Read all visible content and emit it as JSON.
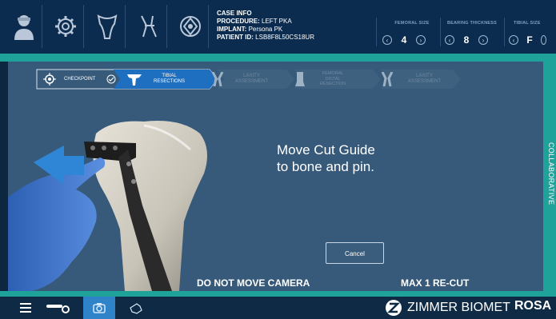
{
  "header": {
    "case_title": "CASE INFO",
    "procedure_label": "PROCEDURE:",
    "procedure_value": "LEFT PKA",
    "implant_label": "IMPLANT:",
    "implant_value": "Persona PK",
    "patient_label": "PATIENT ID:",
    "patient_value": "LSB8F8L50CS18UR",
    "femoral_size_label": "FEMORAL SIZE",
    "femoral_size_value": "4",
    "bearing_label": "BEARING THICKNESS",
    "bearing_value": "8",
    "tibial_label": "TIBIAL SIZE",
    "tibial_value": "F",
    "icons": [
      "surgeon-icon",
      "settings-gear-icon",
      "femur-icon",
      "knee-leg-icon",
      "tracker-icon"
    ]
  },
  "steps": {
    "checkpoint": "CHECKPOINT",
    "tibial_line1": "TIBIAL",
    "tibial_line2": "RESECTIONS",
    "laxity1_line1": "LAXITY",
    "laxity1_line2": "ASSESSMENT",
    "femoral_line1": "FEMORAL",
    "femoral_line2": "DISTAL",
    "femoral_line3": "RESECTION",
    "laxity2_line1": "LAXITY",
    "laxity2_line2": "ASSESSMENT"
  },
  "main": {
    "instruction_line1": "Move Cut Guide",
    "instruction_line2": "to bone and pin.",
    "cancel_label": "Cancel",
    "warning_left": "DO NOT MOVE CAMERA",
    "warning_right": "MAX 1 RE-CUT"
  },
  "sidebar": {
    "mode_label": "COLLABORATIVE"
  },
  "footer": {
    "brand": "ZIMMER BIOMET",
    "product": "ROSA",
    "icons": [
      "menu-icon",
      "tracker-pointer-icon",
      "camera-icon",
      "hand-icon"
    ]
  },
  "colors": {
    "teal": "#1fa29a",
    "active_blue": "#1f6fc1",
    "panel": "#375a7a"
  }
}
